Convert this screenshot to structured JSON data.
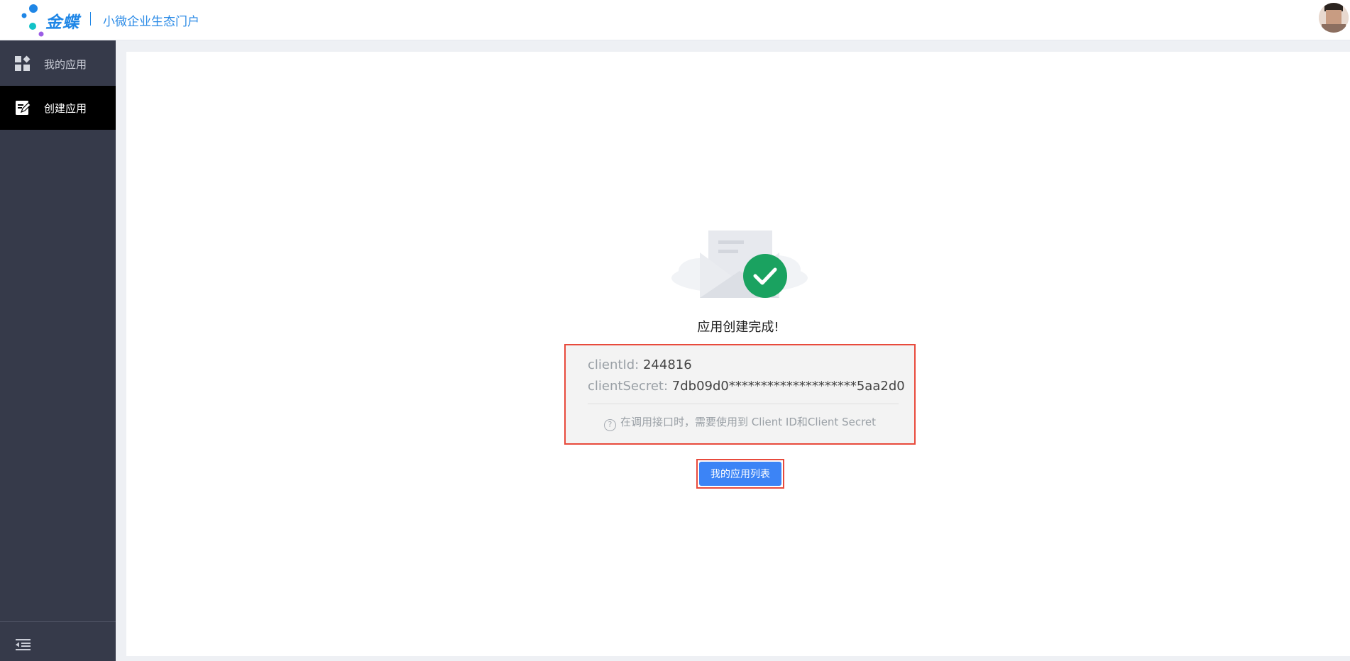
{
  "header": {
    "brand_name": "金蝶",
    "portal_name": "小微企业生态门户"
  },
  "sidebar": {
    "items": [
      {
        "label": "我的应用",
        "icon": "grid-apps-icon",
        "active": false
      },
      {
        "label": "创建应用",
        "icon": "edit-note-icon",
        "active": true
      }
    ],
    "collapse_icon": "collapse-menu-icon"
  },
  "main": {
    "success_title": "应用创建完成!",
    "client_id_label": "clientId: ",
    "client_id_value": "244816",
    "client_secret_label": "clientSecret: ",
    "client_secret_value": "7db09d0********************5aa2d0",
    "hint_text": "在调用接口时，需要使用到 Client ID和Client Secret",
    "hint_icon_glyph": "?",
    "button_label": "我的应用列表"
  },
  "colors": {
    "brand_blue": "#1f86e6",
    "sidebar_bg": "#363a4a",
    "sidebar_active_bg": "#000000",
    "success_green": "#1aa260",
    "button_blue": "#3c84f6",
    "highlight_red": "#e84a3c"
  }
}
